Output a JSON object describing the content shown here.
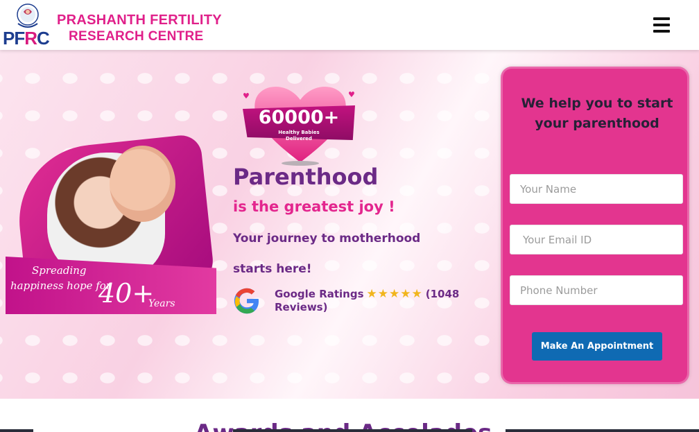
{
  "header": {
    "logo_letters_a": "PF",
    "logo_letters_b": "R",
    "logo_letters_c": "C",
    "brand_line1": "PRASHANTH FERTILITY",
    "brand_line2": "RESEARCH CENTRE",
    "menu_icon": "hamburger-icon"
  },
  "hero": {
    "photo_tag_line1": "Spreading",
    "photo_tag_line2": "happiness hope for",
    "photo_tag_number": "40+",
    "photo_tag_unit": "Years",
    "badge_number": "60000+",
    "badge_caption_line1": "Healthy Babies",
    "badge_caption_line2": "Delivered",
    "title": "Parenthood",
    "subtitle": "is the greatest joy !",
    "journey_line1": "Your journey to motherhood",
    "journey_line2": "starts here!",
    "ratings_label": "Google Ratings",
    "ratings_stars": "★★★★★",
    "ratings_count_a": "(1048",
    "ratings_count_b": "Reviews)",
    "google_icon": "google-icon"
  },
  "form": {
    "heading_line1": "We help you to start",
    "heading_line2": "your parenthood",
    "name_placeholder": "Your Name",
    "email_placeholder": "Your Email ID",
    "phone_placeholder": "Phone Number",
    "submit_label": "Make An Appointment"
  },
  "below": {
    "heading_partial": "Awards and Accolades"
  },
  "colors": {
    "brand_pink": "#e3268e",
    "brand_purple": "#6b2a86",
    "button_blue": "#0f6ab3",
    "form_bg": "#e3358f"
  }
}
